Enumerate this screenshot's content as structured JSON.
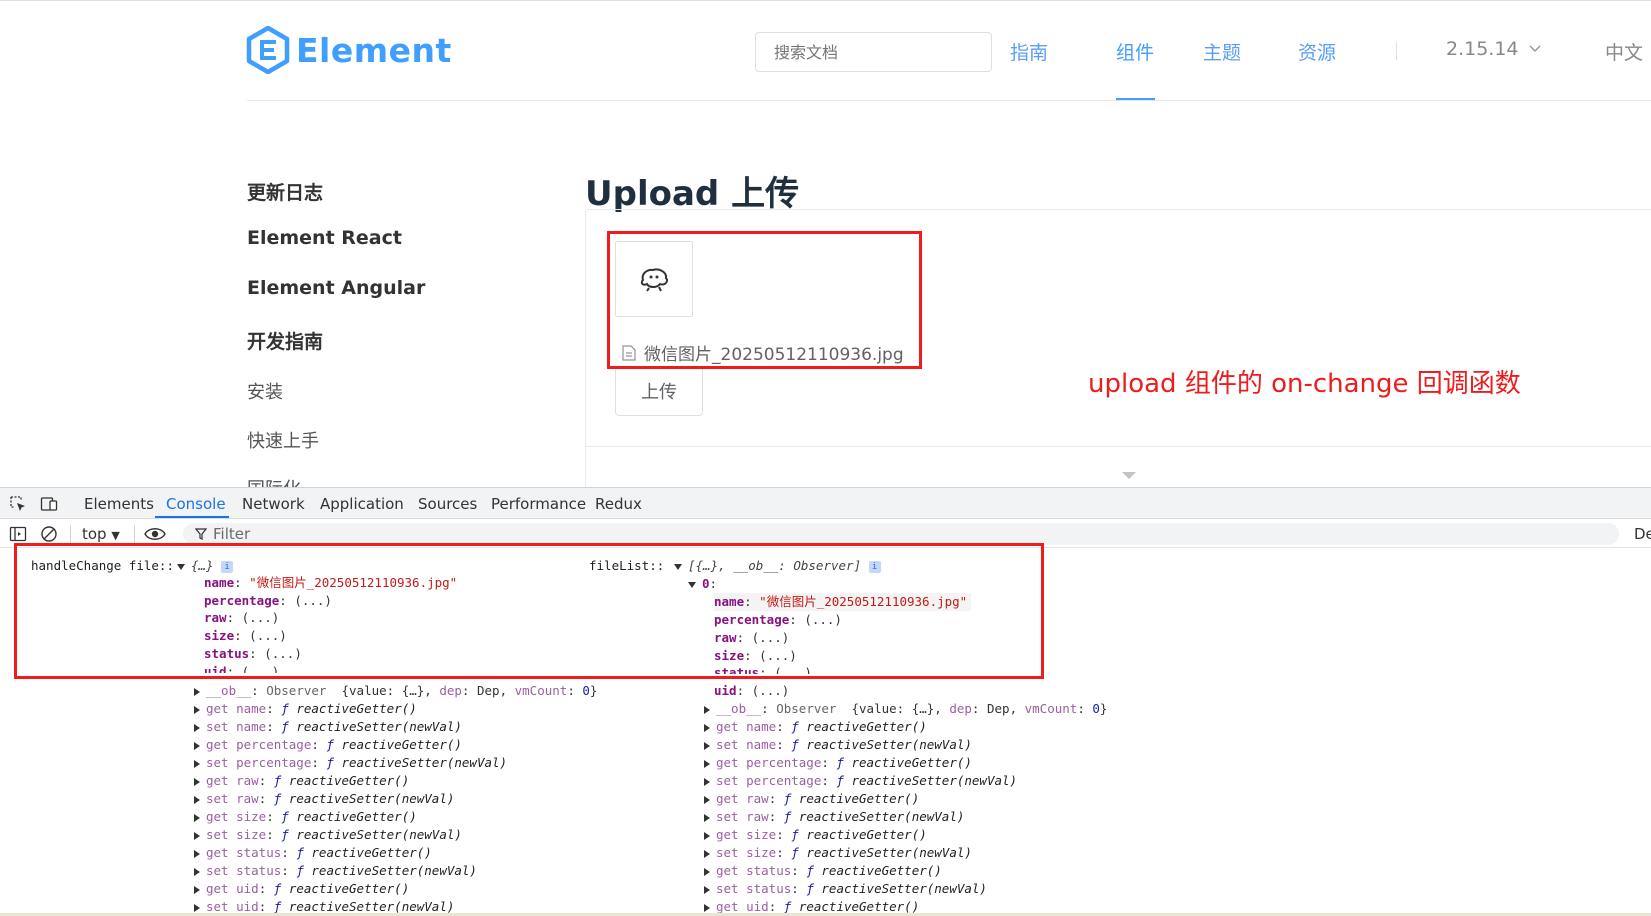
{
  "site": {
    "logo_text": "Element",
    "search_placeholder": "搜索文档",
    "nav": [
      "指南",
      "组件",
      "主题",
      "资源"
    ],
    "active_nav": "组件",
    "version": "2.15.14",
    "language": "中文",
    "sidebar": [
      {
        "label": "更新日志",
        "style": "bold"
      },
      {
        "label": "Element React",
        "style": "bold"
      },
      {
        "label": "Element Angular",
        "style": "bold"
      },
      {
        "label": "开发指南",
        "style": "bold"
      },
      {
        "label": "安装",
        "style": "normal"
      },
      {
        "label": "快速上手",
        "style": "normal"
      },
      {
        "label": "国际化",
        "style": "normal"
      }
    ],
    "page_title": "Upload 上传",
    "file_name": "微信图片_20250512110936.jpg",
    "upload_button": "上传",
    "annotation": "upload 组件的 on-change 回调函数",
    "colors": {
      "brand": "#409eff",
      "annotation_red": "#ee1c1c"
    }
  },
  "devtools": {
    "tabs": [
      "Elements",
      "Console",
      "Network",
      "Application",
      "Sources",
      "Performance",
      "Redux"
    ],
    "active_tab": "Console",
    "context": "top",
    "filter_placeholder": "Filter",
    "right_label": "De"
  },
  "console": {
    "left": {
      "label": "handleChange file::",
      "summary": "{…}",
      "fields": [
        {
          "key": "name",
          "value": "\"微信图片_20250512110936.jpg\""
        },
        {
          "key": "percentage",
          "value": "(...)"
        },
        {
          "key": "raw",
          "value": "(...)"
        },
        {
          "key": "size",
          "value": "(...)"
        },
        {
          "key": "status",
          "value": "(...)"
        },
        {
          "key": "uid",
          "value": "(...)"
        }
      ],
      "observer": {
        "key": "__ob__",
        "type": "Observer",
        "detail_pre": "{value: {…}, ",
        "dep_key": "dep",
        "dep_val": "Dep",
        "vm_key": "vmCount",
        "vm_val": "0"
      },
      "accessors": [
        {
          "key": "get name",
          "fn": "reactiveGetter()"
        },
        {
          "key": "set name",
          "fn": "reactiveSetter(newVal)"
        },
        {
          "key": "get percentage",
          "fn": "reactiveGetter()"
        },
        {
          "key": "set percentage",
          "fn": "reactiveSetter(newVal)"
        },
        {
          "key": "get raw",
          "fn": "reactiveGetter()"
        },
        {
          "key": "set raw",
          "fn": "reactiveSetter(newVal)"
        },
        {
          "key": "get size",
          "fn": "reactiveGetter()"
        },
        {
          "key": "set size",
          "fn": "reactiveSetter(newVal)"
        },
        {
          "key": "get status",
          "fn": "reactiveGetter()"
        },
        {
          "key": "set status",
          "fn": "reactiveSetter(newVal)"
        },
        {
          "key": "get uid",
          "fn": "reactiveGetter()"
        },
        {
          "key": "set uid",
          "fn": "reactiveSetter(newVal)"
        }
      ]
    },
    "right": {
      "label": "fileList::",
      "summary": "[{…}, __ob__: Observer]",
      "index": "0",
      "fields": [
        {
          "key": "name",
          "value": "\"微信图片_20250512110936.jpg\""
        },
        {
          "key": "percentage",
          "value": "(...)"
        },
        {
          "key": "raw",
          "value": "(...)"
        },
        {
          "key": "size",
          "value": "(...)"
        },
        {
          "key": "status",
          "value": "(...)"
        },
        {
          "key": "uid",
          "value": "(...)"
        }
      ],
      "observer": {
        "key": "__ob__",
        "type": "Observer",
        "detail_pre": "{value: {…}, ",
        "dep_key": "dep",
        "dep_val": "Dep",
        "vm_key": "vmCount",
        "vm_val": "0"
      },
      "accessors": [
        {
          "key": "get name",
          "fn": "reactiveGetter()"
        },
        {
          "key": "set name",
          "fn": "reactiveSetter(newVal)"
        },
        {
          "key": "get percentage",
          "fn": "reactiveGetter()"
        },
        {
          "key": "set percentage",
          "fn": "reactiveSetter(newVal)"
        },
        {
          "key": "get raw",
          "fn": "reactiveGetter()"
        },
        {
          "key": "set raw",
          "fn": "reactiveSetter(newVal)"
        },
        {
          "key": "get size",
          "fn": "reactiveGetter()"
        },
        {
          "key": "set size",
          "fn": "reactiveSetter(newVal)"
        },
        {
          "key": "get status",
          "fn": "reactiveGetter()"
        },
        {
          "key": "set status",
          "fn": "reactiveSetter(newVal)"
        },
        {
          "key": "get uid",
          "fn": "reactiveGetter()"
        }
      ]
    }
  }
}
